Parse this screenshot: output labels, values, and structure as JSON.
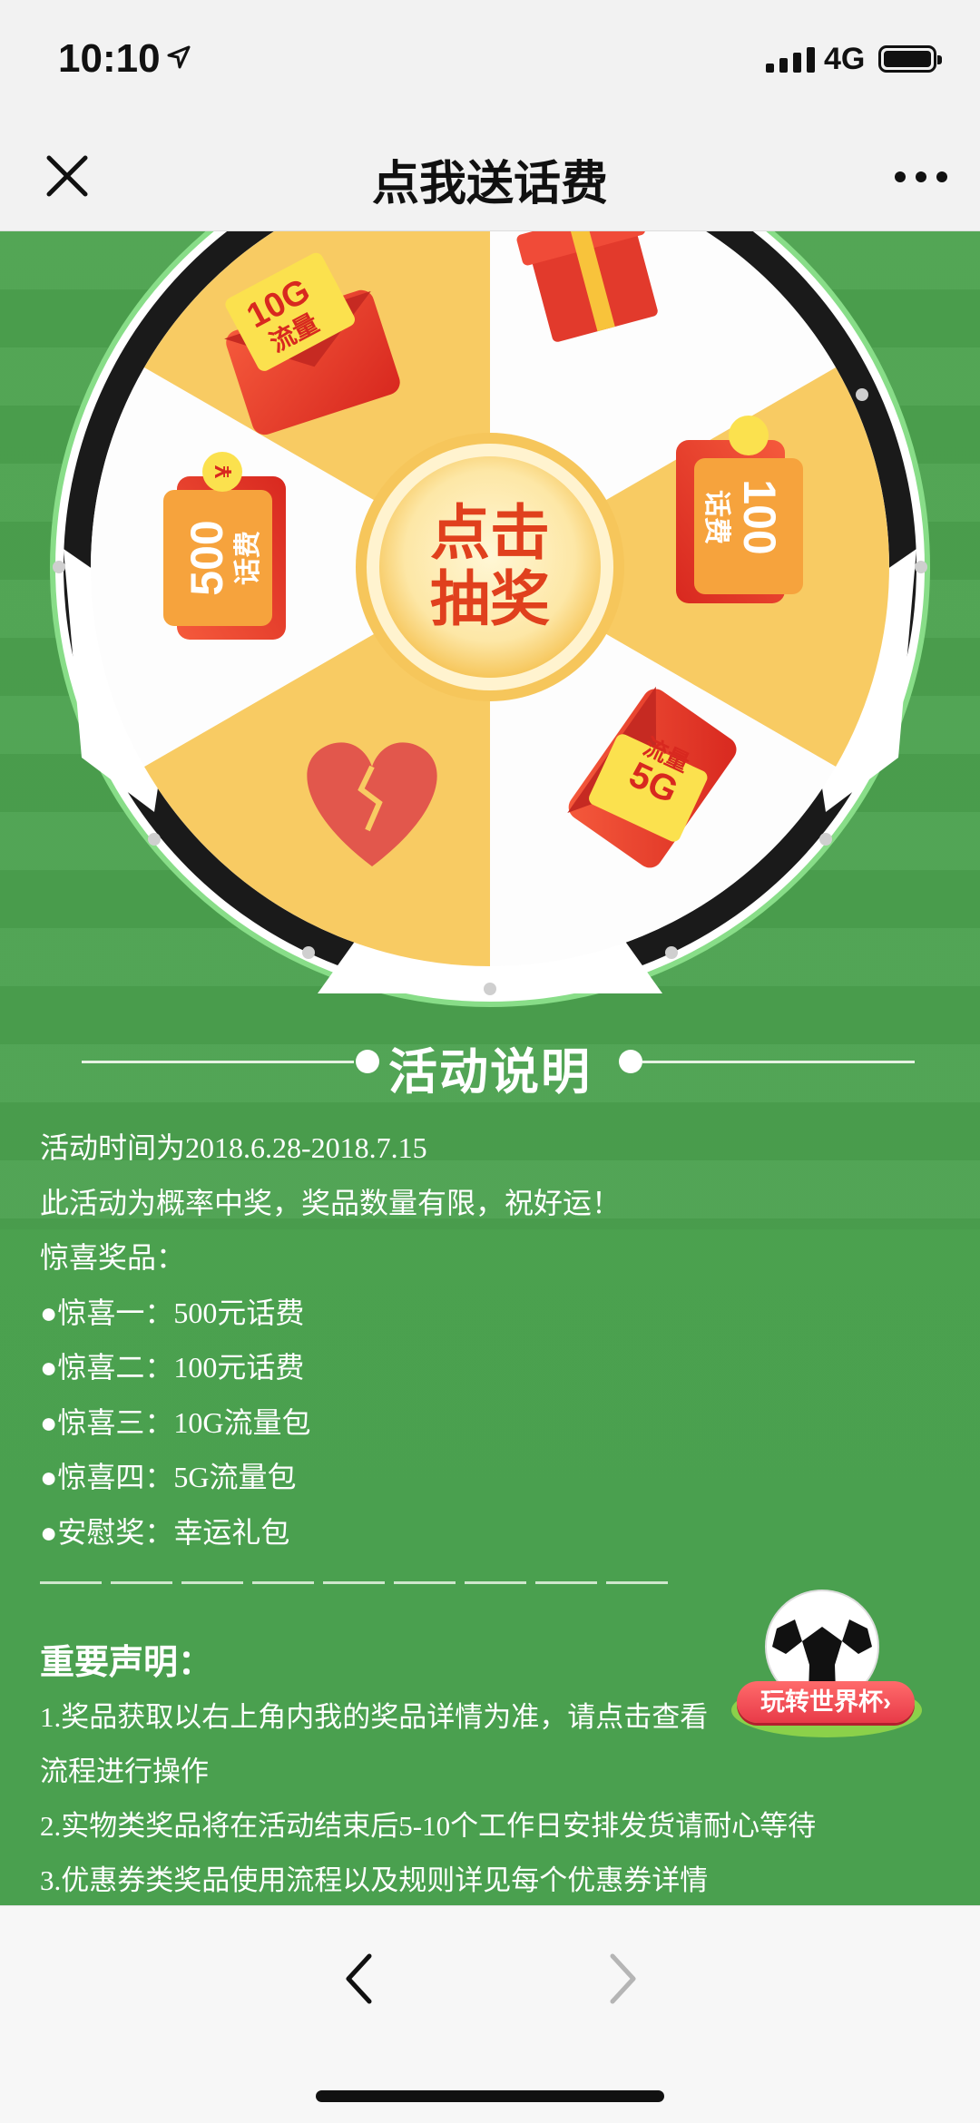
{
  "status_bar": {
    "time": "10:10",
    "network": "4G"
  },
  "header": {
    "title": "点我送话费"
  },
  "wheel": {
    "center_label_line1": "点击",
    "center_label_line2": "抽奖",
    "prizes": [
      {
        "line1": "10G",
        "line2": "流量"
      },
      {
        "line1": "100",
        "line2": "话费"
      },
      {
        "line1": "5G",
        "line2": "流量"
      },
      {
        "line1": "500",
        "line2": "话费"
      },
      {
        "line1": "¥",
        "line2": ""
      }
    ],
    "colors": {
      "yellow": "#f8cb63",
      "white": "#fdfdfd",
      "red": "#e63b2e",
      "orange": "#f6a33d"
    }
  },
  "section": {
    "title": "活动说明"
  },
  "rules": [
    "活动时间为2018.6.28-2018.7.15",
    "此活动为概率中奖，奖品数量有限，祝好运！",
    "惊喜奖品：",
    "●惊喜一：500元话费",
    "●惊喜二：100元话费",
    "●惊喜三：10G流量包",
    "●惊喜四：5G流量包",
    "●安慰奖：幸运礼包"
  ],
  "notice": {
    "heading": "重要声明：",
    "items": [
      "1.奖品获取以右上角内我的奖品详情为准，请点击查看",
      "流程进行操作",
      "2.实物类奖品将在活动结束后5-10个工作日安排发货请耐心等待",
      "3.优惠券类奖品使用流程以及规则详见每个优惠券详情"
    ]
  },
  "worldcup_badge": {
    "label": "玩转世界杯›"
  },
  "colors": {
    "background_green": "#4ca24e",
    "badge_red": "#e83a48"
  }
}
